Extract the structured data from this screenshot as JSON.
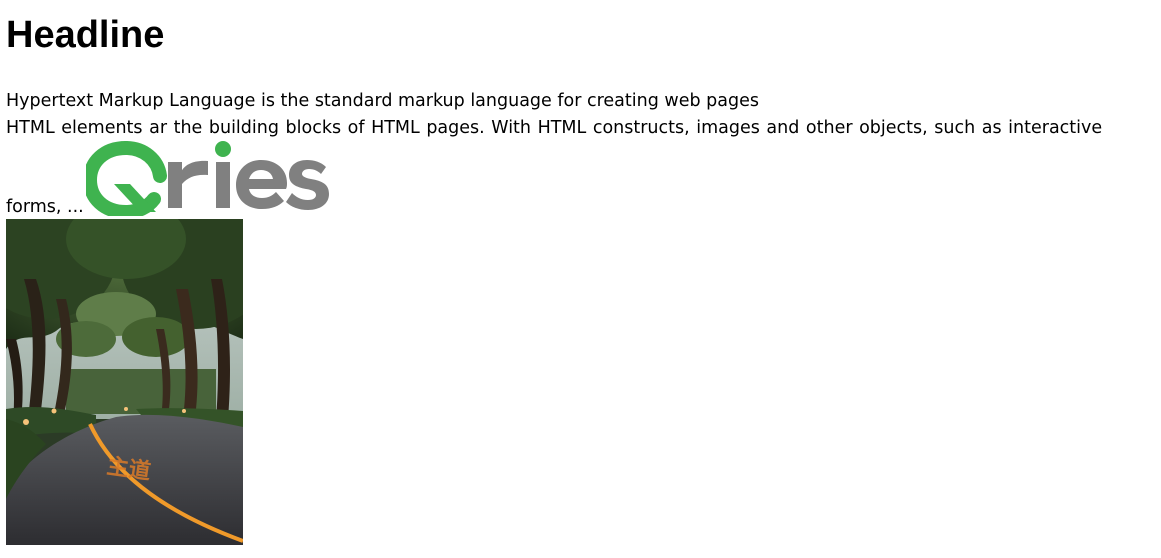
{
  "document": {
    "headline": "Headline",
    "paragraph_line_1": "Hypertext Markup Language is the standard markup language for creating web pages",
    "paragraph_line_2": "HTML elements ar the building blocks of HTML pages. With HTML constructs, images and other objects, such as interactive",
    "paragraph_line_3": "forms, ..."
  },
  "logo": {
    "text": "Qries",
    "colors": {
      "q": "#3fb34f",
      "letters": "#808080"
    }
  },
  "photo": {
    "road_marking_text": "主道",
    "colors": {
      "sky": "#b9c4c0",
      "foliage": "#2f4a24",
      "road": "#3a3a3e",
      "centerline": "#f09a2a"
    }
  }
}
